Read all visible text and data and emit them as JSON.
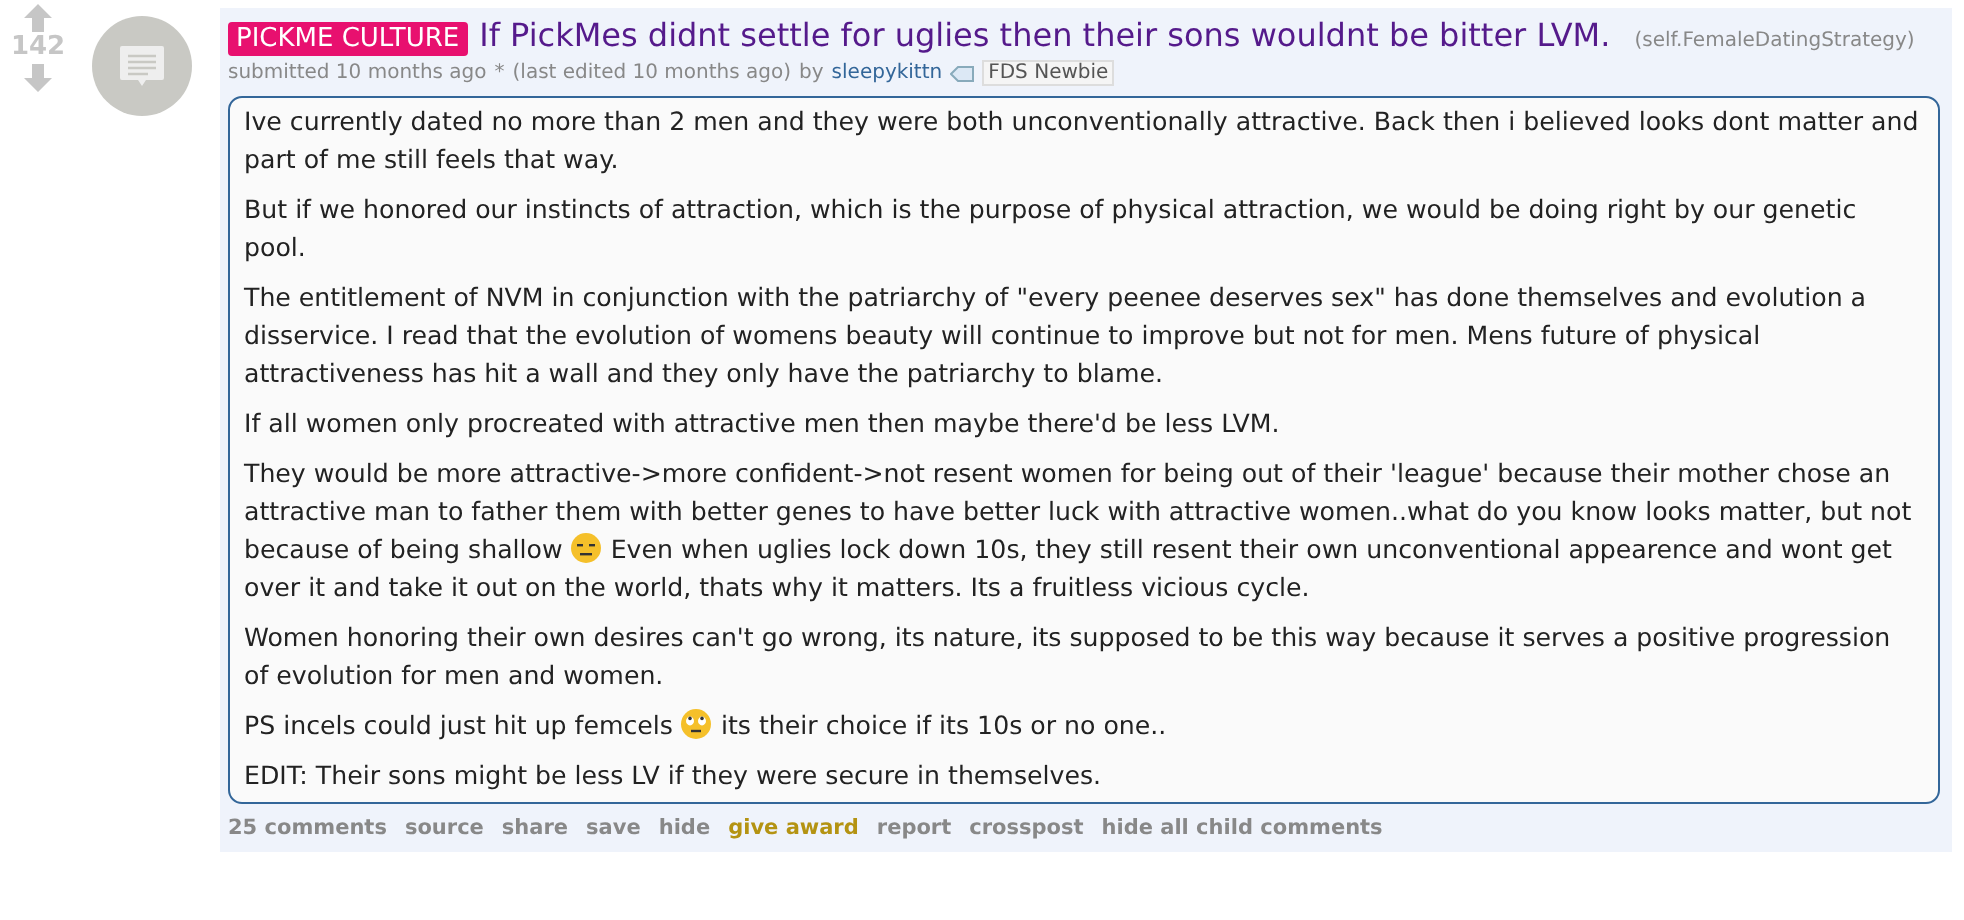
{
  "vote": {
    "score": "142"
  },
  "post": {
    "flair": "PICKME CULTURE",
    "title": "If PickMes didnt settle for uglies then their sons wouldnt be bitter LVM.",
    "domain": "(self.FemaleDatingStrategy)",
    "tagline": {
      "submitted": "submitted 10 months ago",
      "edited_mark": "*",
      "edited": "(last edited 10 months ago)",
      "by": "by",
      "author": "sleepykittn",
      "author_flair": "FDS Newbie"
    },
    "body": [
      [
        {
          "kind": "text",
          "text": "Ive currently dated no more than 2 men and they were both unconventionally attractive. Back then i believed looks dont matter and part of me still feels that way."
        }
      ],
      [
        {
          "kind": "text",
          "text": "But if we honored our instincts of attraction, which is the purpose of physical attraction, we would be doing right by our genetic pool."
        }
      ],
      [
        {
          "kind": "text",
          "text": "The entitlement of NVM in conjunction with the patriarchy of \"every peenee deserves sex\" has done themselves and evolution a disservice. I read that the evolution of womens beauty will continue to improve but not for men. Mens future of physical attractiveness has hit a wall and they only have the patriarchy to blame."
        }
      ],
      [
        {
          "kind": "text",
          "text": "If all women only procreated with attractive men then maybe there'd be less LVM."
        }
      ],
      [
        {
          "kind": "text",
          "text": "They would be more attractive->more confident->not resent women for being out of their 'league' because their mother chose an attractive man to father them with better genes to have better luck with attractive women..what do you know looks matter, but not because of being shallow"
        },
        {
          "kind": "emoji_flat"
        },
        {
          "kind": "text",
          "text": "Even when uglies lock down 10s, they still resent their own unconventional appearence and wont get over it and take it out on the world, thats why it matters. Its a fruitless vicious cycle."
        }
      ],
      [
        {
          "kind": "text",
          "text": "Women honoring their own desires can't go wrong, its nature, its supposed to be this way because it serves a positive progression of evolution for men and women."
        }
      ],
      [
        {
          "kind": "text",
          "text": "PS incels could just hit up femcels"
        },
        {
          "kind": "emoji_eyeroll"
        },
        {
          "kind": "text",
          "text": "its their choice if its 10s or no one.."
        }
      ],
      [
        {
          "kind": "text",
          "text": "EDIT: Their sons might be less LV if they were secure in themselves."
        }
      ]
    ],
    "buttons": [
      {
        "label": "25 comments",
        "kind": "normal"
      },
      {
        "label": "source",
        "kind": "normal"
      },
      {
        "label": "share",
        "kind": "normal"
      },
      {
        "label": "save",
        "kind": "normal"
      },
      {
        "label": "hide",
        "kind": "normal"
      },
      {
        "label": "give award",
        "kind": "award"
      },
      {
        "label": "report",
        "kind": "normal"
      },
      {
        "label": "crosspost",
        "kind": "normal"
      },
      {
        "label": "hide all child comments",
        "kind": "normal"
      }
    ]
  }
}
